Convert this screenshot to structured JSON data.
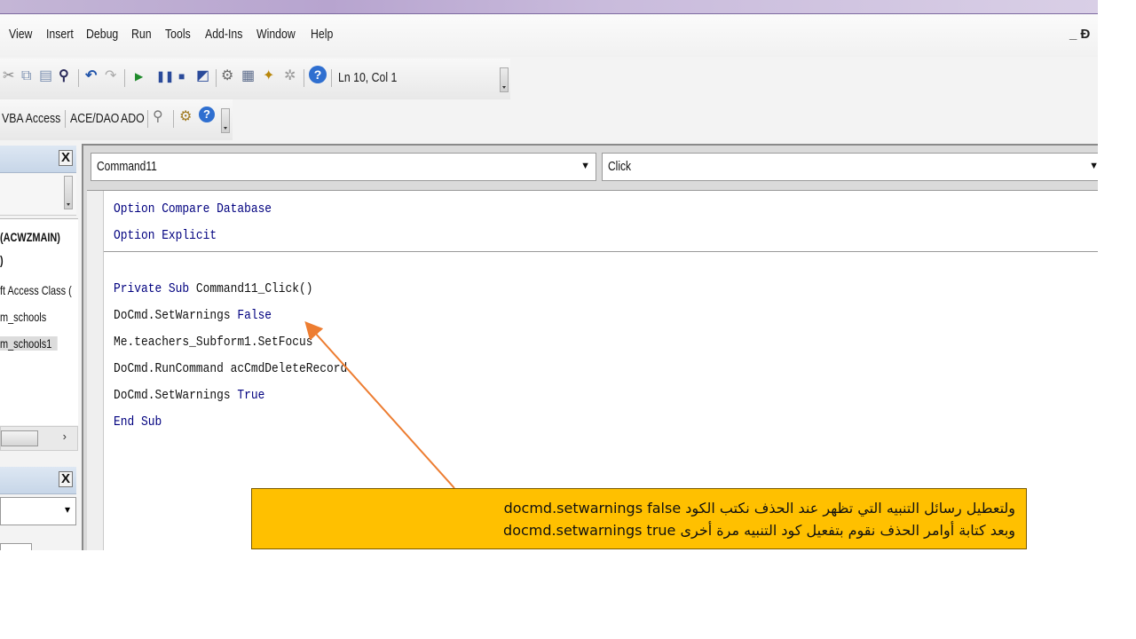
{
  "menubar": {
    "items": [
      "View",
      "Insert",
      "Debug",
      "Run",
      "Tools",
      "Add-Ins",
      "Window",
      "Help"
    ],
    "window_controls": "_ Ɖ"
  },
  "toolbar_standard": {
    "position_label": "Ln 10, Col 1",
    "icons": [
      "cut-icon",
      "copy-icon",
      "paste-icon",
      "find-icon",
      "undo-icon",
      "redo-icon",
      "run-icon",
      "break-icon",
      "reset-icon",
      "design-mode-icon",
      "project-explorer-icon",
      "properties-icon",
      "object-browser-icon",
      "toolbox-icon",
      "help-icon"
    ]
  },
  "toolbar_custom": {
    "items": [
      "VBA Access",
      "ACE/DAO",
      "ADO"
    ],
    "icons": [
      "search-icon",
      "gear-icon",
      "help-icon"
    ]
  },
  "project_panel": {
    "close_label": "X",
    "tree_items": [
      "(ACWZMAIN)",
      ")",
      "ft Access Class (",
      "m_schools",
      "m_schools1"
    ]
  },
  "properties_panel": {
    "close_label": "X",
    "dropdown_arrow": "▾"
  },
  "code_window": {
    "object_combo": "Command11",
    "procedure_combo": "Click",
    "lines": [
      {
        "parts": [
          {
            "t": "Option Compare Database",
            "k": true
          }
        ]
      },
      {
        "parts": [
          {
            "t": "Option Explicit",
            "k": true
          }
        ]
      },
      {
        "parts": [
          {
            "t": "",
            "k": false
          }
        ]
      },
      {
        "parts": [
          {
            "t": "Private Sub",
            "k": true
          },
          {
            "t": " Command11_Click()",
            "k": false
          }
        ]
      },
      {
        "parts": [
          {
            "t": "DoCmd.SetWarnings ",
            "k": false
          },
          {
            "t": "False",
            "k": true
          }
        ]
      },
      {
        "parts": [
          {
            "t": "Me.teachers_Subform1.SetFocus",
            "k": false
          }
        ]
      },
      {
        "parts": [
          {
            "t": "DoCmd.RunCommand acCmdDeleteRecord",
            "k": false
          }
        ]
      },
      {
        "parts": [
          {
            "t": "DoCmd.SetWarnings ",
            "k": false
          },
          {
            "t": "True",
            "k": true
          }
        ]
      },
      {
        "parts": [
          {
            "t": "End Sub",
            "k": true
          }
        ]
      }
    ]
  },
  "annotation": {
    "line1": "ولتعطيل رسائل التنبيه التي تظهر عند الحذف نكتب الكود docmd.setwarnings false",
    "line2": "وبعد كتابة أوامر الحذف نقوم بتفعيل كود التنبيه مرة أخرى docmd.setwarnings true",
    "accent_color": "#ffc000",
    "arrow_color": "#ed7d31"
  }
}
